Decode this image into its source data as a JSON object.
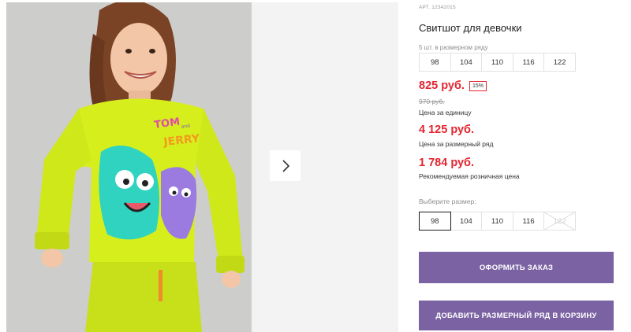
{
  "gallery": {
    "next_icon": "chevron-right-icon",
    "photo_print_line1": "TOM",
    "photo_print_and": "and",
    "photo_print_line2": "JERRY"
  },
  "product": {
    "sku": "АРТ. 12342015",
    "title": "Свитшот для девочки",
    "pack_label": "5 шт. в размерном ряду",
    "pack_sizes": [
      "98",
      "104",
      "110",
      "116",
      "122"
    ],
    "price": "825 руб.",
    "discount": "15%",
    "old_price": "970 руб.",
    "unit_caption": "Цена за единицу",
    "pack_price": "4 125 руб.",
    "pack_caption": "Цена за размерный ряд",
    "retail_price": "1 784 руб.",
    "retail_caption": "Рекомендуемая розничная цена",
    "choose_label": "Выберите размер:",
    "choose_sizes": [
      {
        "label": "98",
        "state": "selected"
      },
      {
        "label": "104",
        "state": "available"
      },
      {
        "label": "110",
        "state": "available"
      },
      {
        "label": "116",
        "state": "available"
      },
      {
        "label": "122",
        "state": "unavailable"
      }
    ],
    "order_button": "ОФОРМИТЬ ЗАКАЗ",
    "cart_button": "ДОБАВИТЬ РАЗМЕРНЫЙ РЯД В КОРЗИНУ"
  },
  "colors": {
    "accent": "#7b62a3",
    "price_red": "#e4252f",
    "sweatshirt": "#d6ef1c"
  }
}
